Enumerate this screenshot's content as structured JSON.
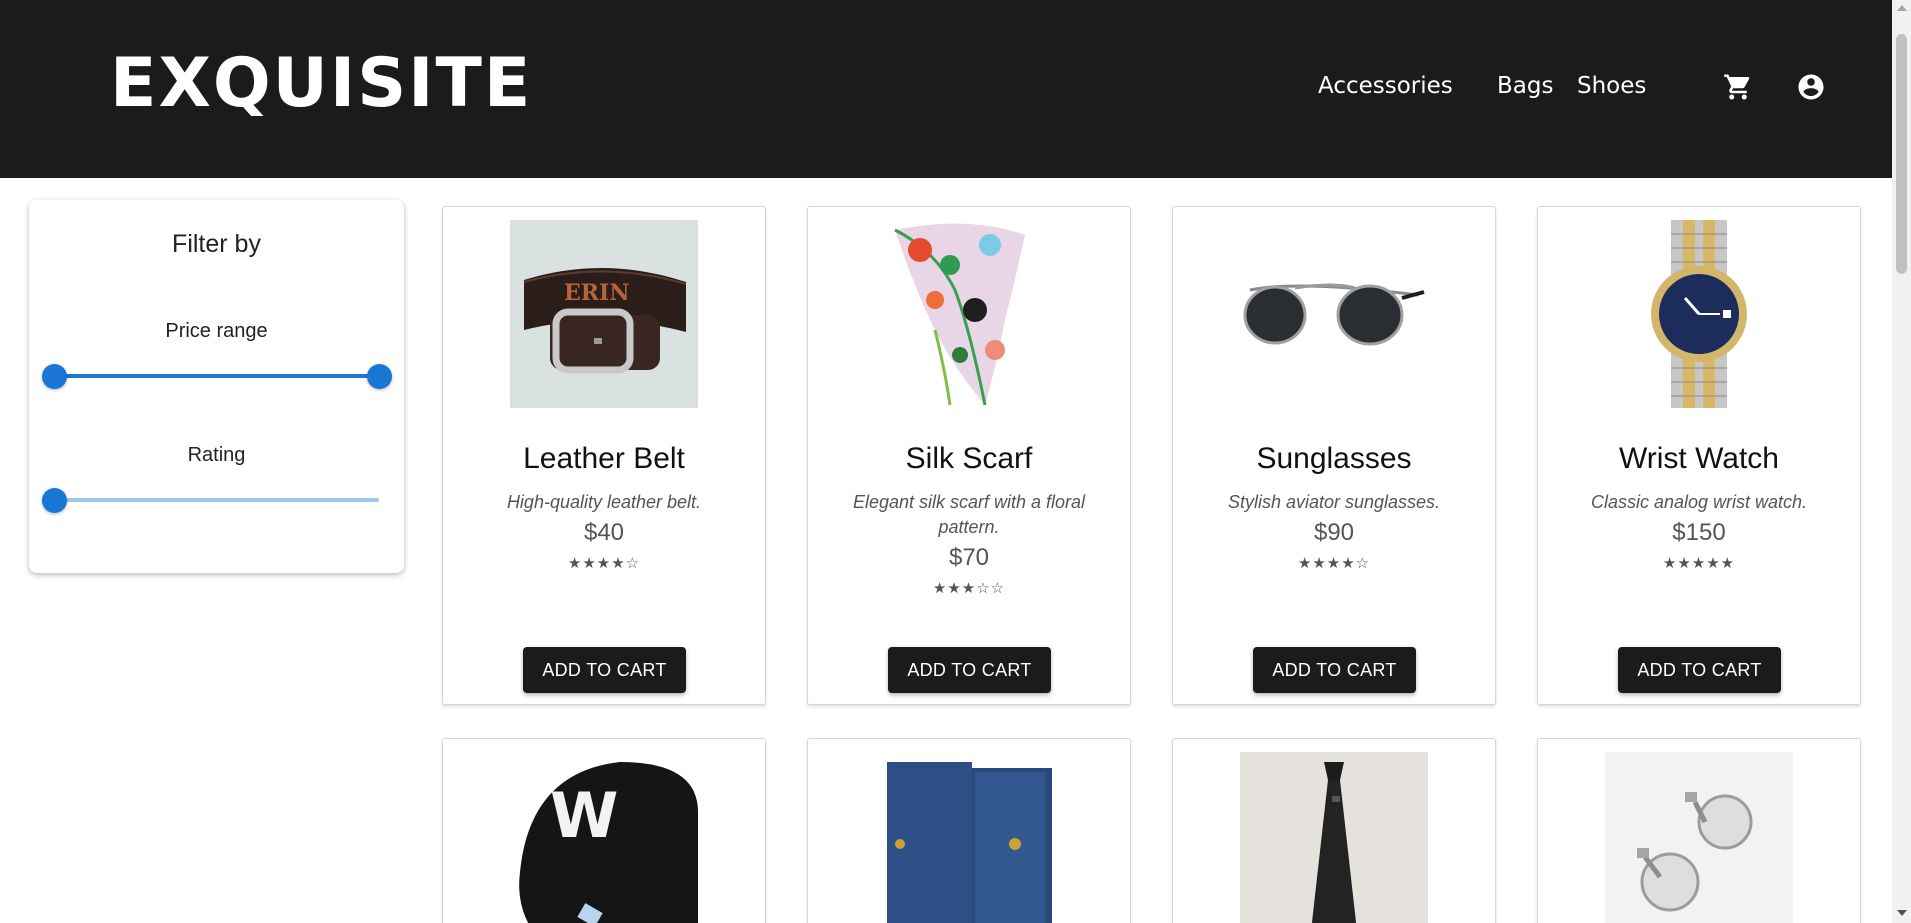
{
  "header": {
    "logo": "EXQUISITE",
    "nav": [
      "Accessories",
      "Bags",
      "Shoes"
    ],
    "icons": [
      "cart-icon",
      "account-circle-icon"
    ]
  },
  "filter": {
    "title": "Filter by",
    "price_label": "Price range",
    "price_range_fraction": [
      0,
      1
    ],
    "rating_label": "Rating",
    "rating_fraction": 0
  },
  "products": [
    {
      "name": "Leather Belt",
      "description": "High-quality leather belt.",
      "price": "$40",
      "stars": "★★★★☆",
      "button": "ADD TO CART"
    },
    {
      "name": "Silk Scarf",
      "description": "Elegant silk scarf with a floral pattern.",
      "price": "$70",
      "stars": "★★★☆☆",
      "button": "ADD TO CART"
    },
    {
      "name": "Sunglasses",
      "description": "Stylish aviator sunglasses.",
      "price": "$90",
      "stars": "★★★★☆",
      "button": "ADD TO CART"
    },
    {
      "name": "Wrist Watch",
      "description": "Classic analog wrist watch.",
      "price": "$150",
      "stars": "★★★★★",
      "button": "ADD TO CART"
    }
  ],
  "products_row2_images": [
    "baseball-cap-image",
    "wallet-image",
    "necktie-image",
    "cufflinks-image"
  ],
  "colors": {
    "header_bg": "#1b1b1b",
    "accent": "#1976d2",
    "button_bg": "#1b1b1b"
  }
}
